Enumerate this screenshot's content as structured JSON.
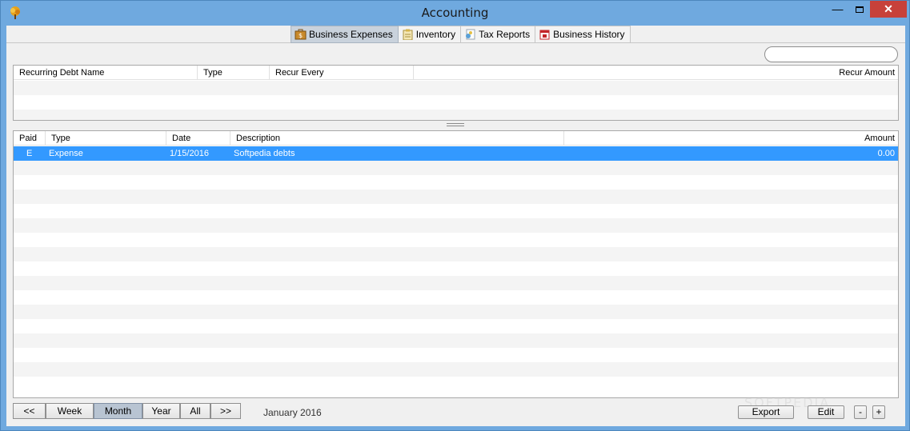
{
  "window": {
    "title": "Accounting",
    "minimize": "—",
    "close": "✕"
  },
  "tabs": [
    {
      "label": "Business Expenses",
      "active": true
    },
    {
      "label": "Inventory",
      "active": false
    },
    {
      "label": "Tax Reports",
      "active": false
    },
    {
      "label": "Business History",
      "active": false
    }
  ],
  "search": {
    "value": ""
  },
  "recurring": {
    "columns": [
      "Recurring Debt Name",
      "Type",
      "Recur Every",
      "Recur Amount"
    ],
    "rows": []
  },
  "transactions": {
    "columns": [
      "Paid",
      "Type",
      "Date",
      "Description",
      "Amount"
    ],
    "rows": [
      {
        "paid": "E",
        "type": "Expense",
        "date": "1/15/2016",
        "description": "Softpedia debts",
        "amount": "0.00"
      }
    ]
  },
  "period": {
    "buttons": [
      "<<",
      "Week",
      "Month",
      "Year",
      "All",
      ">>"
    ],
    "active": "Month",
    "label": "January 2016"
  },
  "actions": {
    "export": "Export",
    "edit": "Edit",
    "minus": "-",
    "plus": "+"
  },
  "watermark": "SOFTPEDIA"
}
